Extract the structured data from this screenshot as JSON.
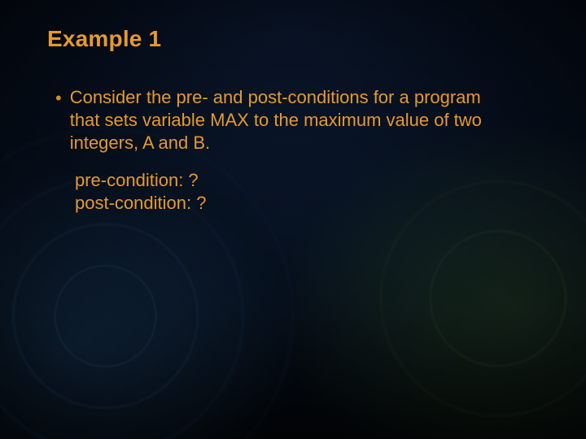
{
  "slide": {
    "title": "Example 1",
    "bullet1": "Consider the pre- and post-conditions for a program that sets variable MAX to the maximum value of two integers, A and B.",
    "pre_line": "pre-condition:  ?",
    "post_line": "post-condition:  ?"
  },
  "colors": {
    "accent": "#e6992f"
  }
}
